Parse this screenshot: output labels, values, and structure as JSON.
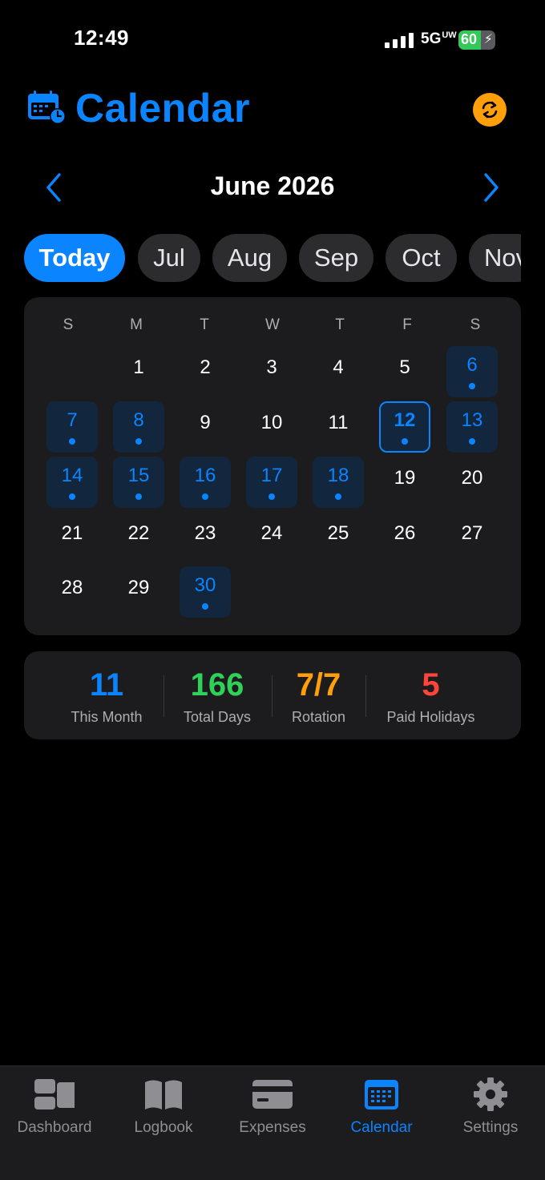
{
  "status_bar": {
    "time": "12:49",
    "network": "5G",
    "network_sup": "UW",
    "battery": "60",
    "battery_level": 0.6
  },
  "header": {
    "title": "Calendar",
    "app_icon": "calendar-clock-icon",
    "sync_icon": "sync-icon"
  },
  "month_nav": {
    "title": "June 2026",
    "prev_icon": "chevron-left-icon",
    "next_icon": "chevron-right-icon"
  },
  "chips": [
    "Today",
    "Jul",
    "Aug",
    "Sep",
    "Oct",
    "Nov"
  ],
  "calendar": {
    "weekdays": [
      "S",
      "M",
      "T",
      "W",
      "T",
      "F",
      "S"
    ],
    "first_weekday_index": 1,
    "days_in_month": 30,
    "work_days": [
      6,
      7,
      8,
      12,
      13,
      14,
      15,
      16,
      17,
      18,
      30
    ],
    "today": 12
  },
  "stats": [
    {
      "value": "11",
      "label": "This Month",
      "color": "#0a84ff"
    },
    {
      "value": "166",
      "label": "Total Days",
      "color": "#30d158"
    },
    {
      "value": "7/7",
      "label": "Rotation",
      "color": "#ff9f0a"
    },
    {
      "value": "5",
      "label": "Paid Holidays",
      "color": "#ff453a"
    }
  ],
  "tabbar": {
    "items": [
      {
        "label": "Dashboard",
        "icon": "dashboard-icon"
      },
      {
        "label": "Logbook",
        "icon": "book-icon"
      },
      {
        "label": "Expenses",
        "icon": "credit-card-icon"
      },
      {
        "label": "Calendar",
        "icon": "calendar-icon"
      },
      {
        "label": "Settings",
        "icon": "gear-icon"
      }
    ],
    "active": "Calendar"
  },
  "colors": {
    "accent": "#0a84ff",
    "sync": "#ff9f0a",
    "card": "#1c1c1e"
  }
}
